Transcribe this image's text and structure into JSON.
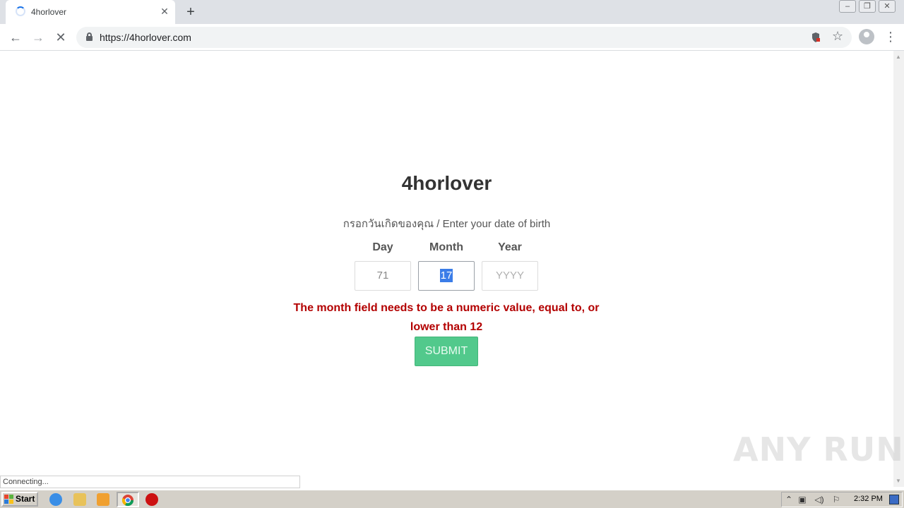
{
  "browser": {
    "tab_title": "4horlover",
    "url": "https://4horlover.com",
    "status_text": "Connecting..."
  },
  "page": {
    "site_title": "4horlover",
    "subtitle": "กรอกวันเกิดของคุณ / Enter your date of birth",
    "fields": {
      "day": {
        "label": "Day",
        "value": "71"
      },
      "month": {
        "label": "Month",
        "value": "17"
      },
      "year": {
        "label": "Year",
        "placeholder": "YYYY"
      }
    },
    "error_message": "The month field needs to be a numeric value, equal to, or lower than 12",
    "submit_label": "SUBMIT"
  },
  "watermark": "ANY RUN",
  "taskbar": {
    "start_label": "Start",
    "clock": "2:32 PM"
  },
  "colors": {
    "accent": "#1a73e8",
    "submit_bg": "#52c98c",
    "error": "#b30000",
    "selection": "#3b7de8"
  }
}
